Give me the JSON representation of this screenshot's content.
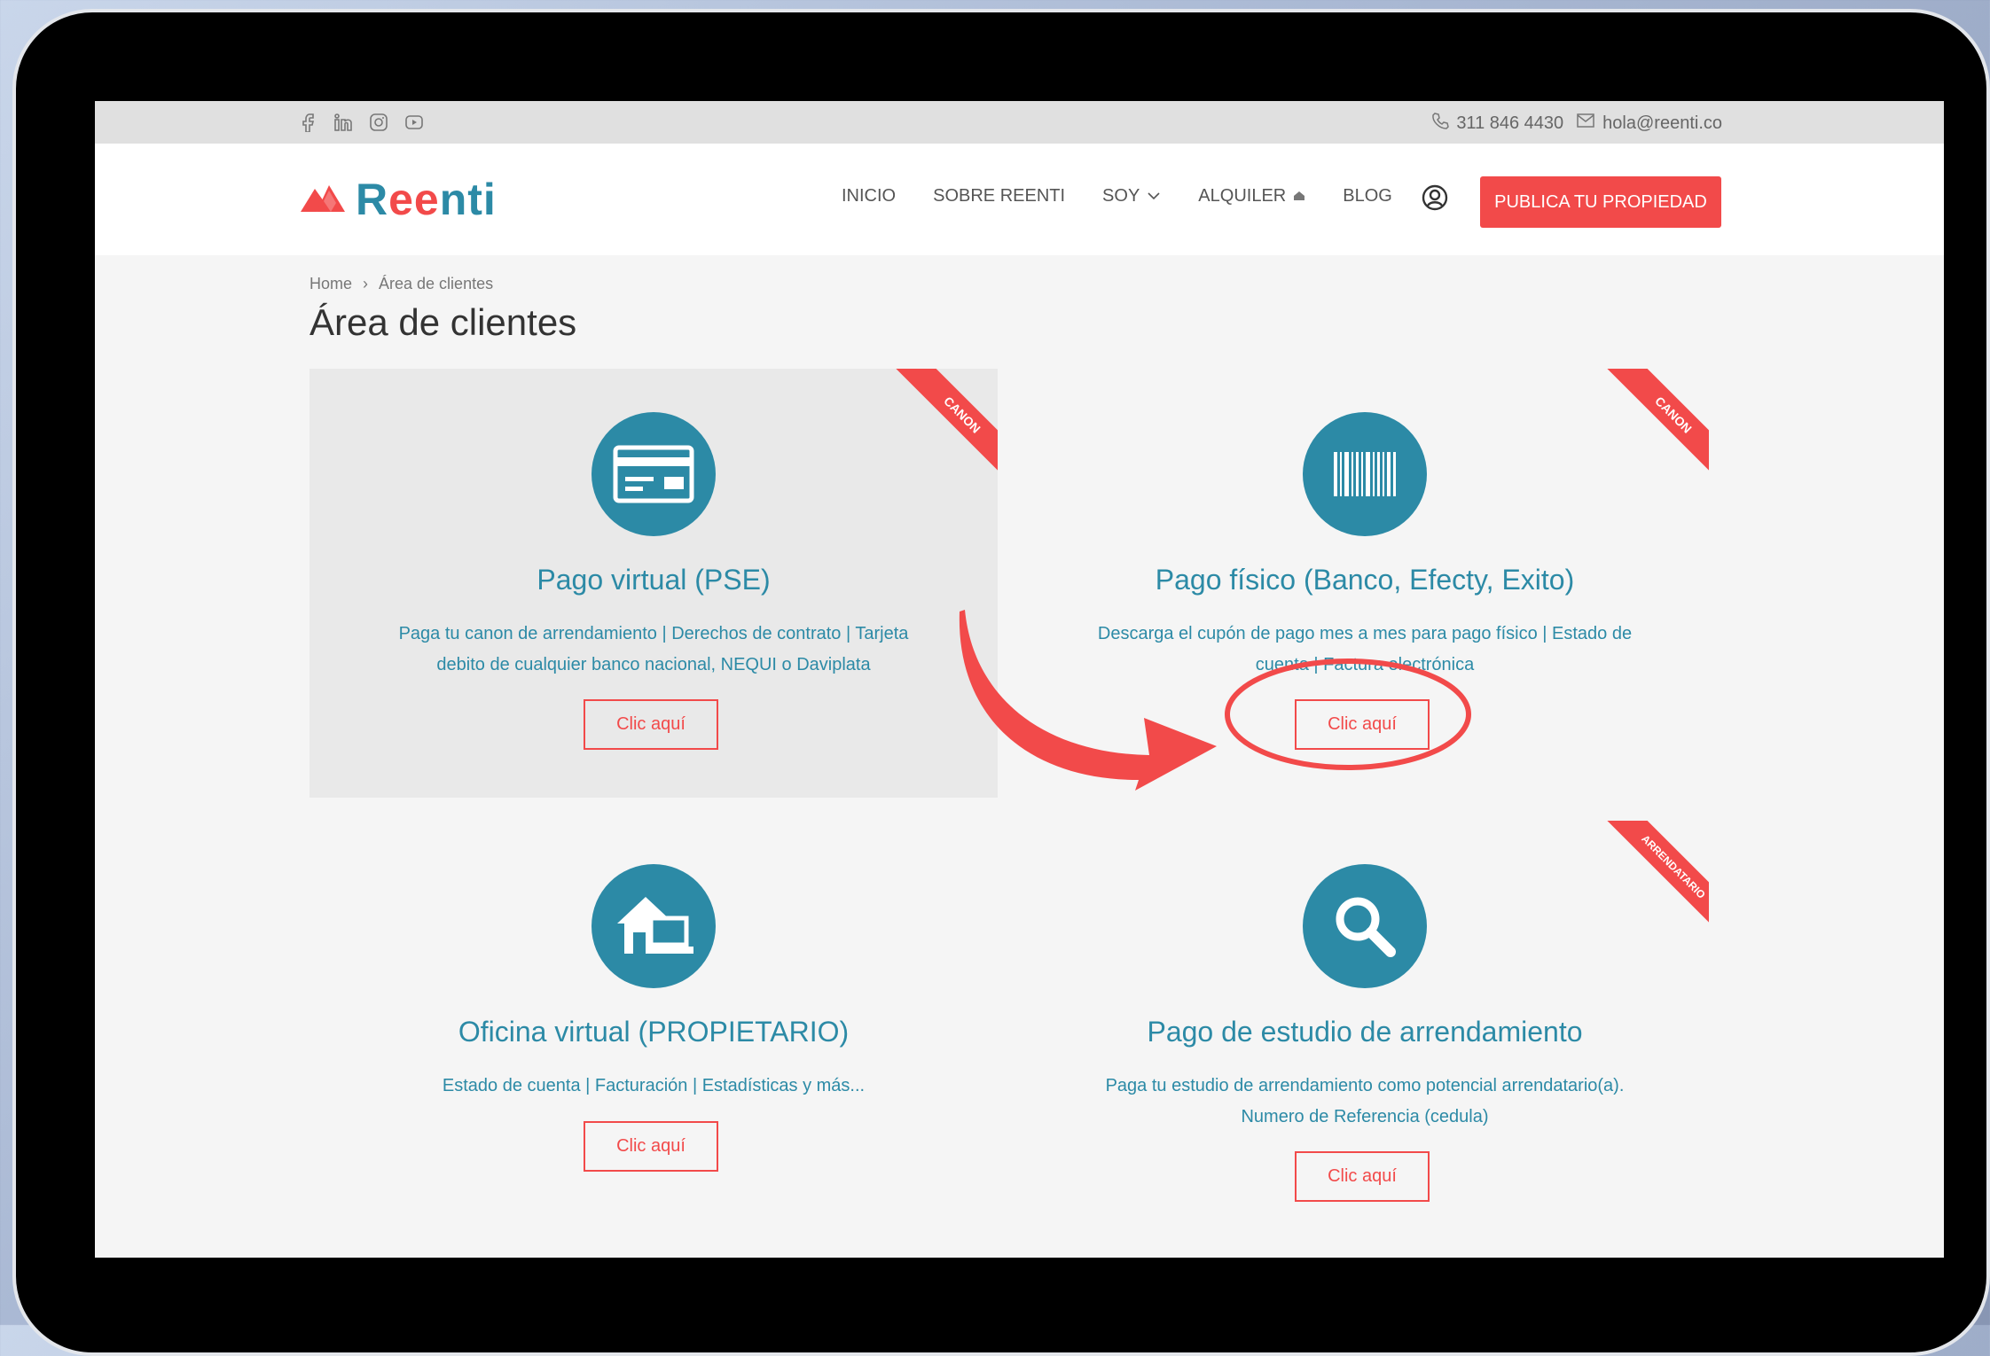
{
  "topbar": {
    "social": [
      "facebook-icon",
      "linkedin-icon",
      "instagram-icon",
      "youtube-icon"
    ],
    "phone": "311 846 4430",
    "email": "hola@reenti.co"
  },
  "nav": {
    "logo_pre": "R",
    "logo_ee": "ee",
    "logo_post": "nti",
    "menu": [
      "INICIO",
      "SOBRE REENTI",
      "SOY",
      "ALQUILER",
      "BLOG"
    ],
    "cta": "PUBLICA TU PROPIEDAD"
  },
  "breadcrumb": {
    "home": "Home",
    "current": "Área de clientes"
  },
  "page_title": "Área de clientes",
  "cards": [
    {
      "title": "Pago virtual (PSE)",
      "desc1": "Paga tu canon de arrendamiento | Derechos de contrato | Tarjeta",
      "desc2": "debito de cualquier banco nacional, NEQUI o Daviplata",
      "button": "Clic aquí",
      "ribbon": "CANON",
      "icon": "credit-card-icon"
    },
    {
      "title": "Pago físico (Banco, Efecty, Exito)",
      "desc1": "Descarga el cupón de pago mes a mes para pago físico | Estado de",
      "desc2": "cuenta | Factura electrónica",
      "button": "Clic aquí",
      "ribbon": "CANON",
      "icon": "barcode-icon"
    },
    {
      "title": "Oficina virtual (PROPIETARIO)",
      "desc1": "Estado de cuenta | Facturación | Estadísticas y más...",
      "button": "Clic aquí",
      "icon": "house-laptop-icon"
    },
    {
      "title": "Pago de estudio de arrendamiento",
      "desc1": "Paga tu estudio de arrendamiento como potencial arrendatario(a).",
      "desc2": "Numero de Referencia (cedula)",
      "button": "Clic aquí",
      "ribbon": "ARRENDATARIO",
      "icon": "magnifier-icon"
    }
  ],
  "colors": {
    "accent": "#f24a4a",
    "brand": "#2c8aa6"
  }
}
